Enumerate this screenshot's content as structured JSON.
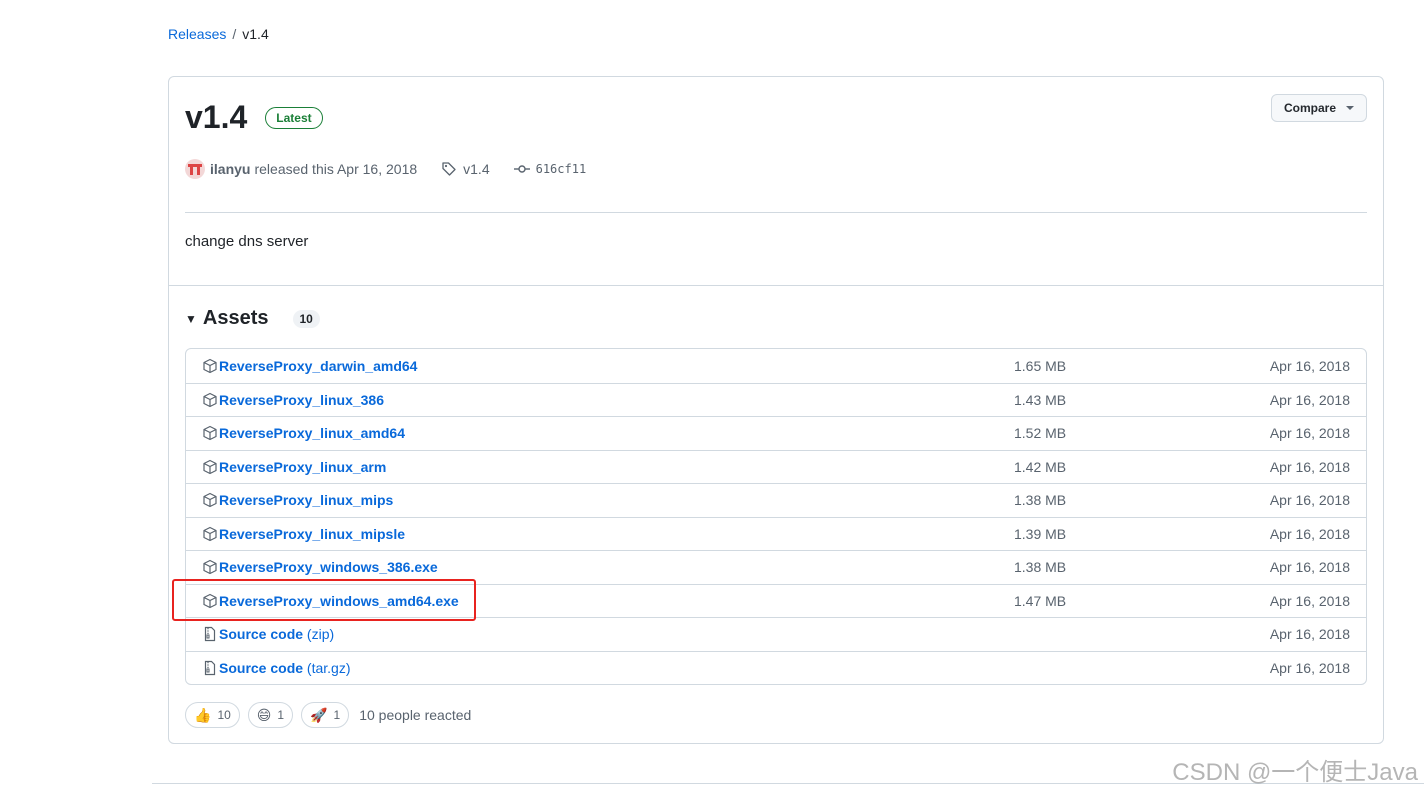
{
  "breadcrumb": {
    "parent": "Releases",
    "separator": "/",
    "current": "v1.4"
  },
  "release": {
    "title": "v1.4",
    "badge": "Latest",
    "compare_label": "Compare",
    "author": "ilanyu",
    "released_text": "released this Apr 16, 2018",
    "tag": "v1.4",
    "commit": "616cf11",
    "body": "change dns server"
  },
  "assets": {
    "label": "Assets",
    "count": "10",
    "rows": [
      {
        "name": "ReverseProxy_darwin_amd64",
        "ext": "",
        "size": "1.65 MB",
        "date": "Apr 16, 2018",
        "icon": "package-icon"
      },
      {
        "name": "ReverseProxy_linux_386",
        "ext": "",
        "size": "1.43 MB",
        "date": "Apr 16, 2018",
        "icon": "package-icon"
      },
      {
        "name": "ReverseProxy_linux_amd64",
        "ext": "",
        "size": "1.52 MB",
        "date": "Apr 16, 2018",
        "icon": "package-icon"
      },
      {
        "name": "ReverseProxy_linux_arm",
        "ext": "",
        "size": "1.42 MB",
        "date": "Apr 16, 2018",
        "icon": "package-icon"
      },
      {
        "name": "ReverseProxy_linux_mips",
        "ext": "",
        "size": "1.38 MB",
        "date": "Apr 16, 2018",
        "icon": "package-icon"
      },
      {
        "name": "ReverseProxy_linux_mipsle",
        "ext": "",
        "size": "1.39 MB",
        "date": "Apr 16, 2018",
        "icon": "package-icon"
      },
      {
        "name": "ReverseProxy_windows_386.exe",
        "ext": "",
        "size": "1.38 MB",
        "date": "Apr 16, 2018",
        "icon": "package-icon"
      },
      {
        "name": "ReverseProxy_windows_amd64.exe",
        "ext": "",
        "size": "1.47 MB",
        "date": "Apr 16, 2018",
        "icon": "package-icon"
      },
      {
        "name": "Source code",
        "ext": "(zip)",
        "size": "",
        "date": "Apr 16, 2018",
        "icon": "file-zip-icon"
      },
      {
        "name": "Source code",
        "ext": "(tar.gz)",
        "size": "",
        "date": "Apr 16, 2018",
        "icon": "file-zip-icon"
      }
    ]
  },
  "reactions": {
    "items": [
      {
        "emoji": "👍",
        "count": "10",
        "icon": "thumbs-up-icon"
      },
      {
        "emoji": "😄",
        "count": "1",
        "icon": "smile-icon"
      },
      {
        "emoji": "🚀",
        "count": "1",
        "icon": "rocket-icon"
      }
    ],
    "summary": "10 people reacted"
  },
  "watermark": "CSDN @一个便士Java",
  "colors": {
    "link": "#0969da",
    "latest": "#1a7f37",
    "highlight": "#e8231f",
    "border": "#d1d9e0"
  }
}
